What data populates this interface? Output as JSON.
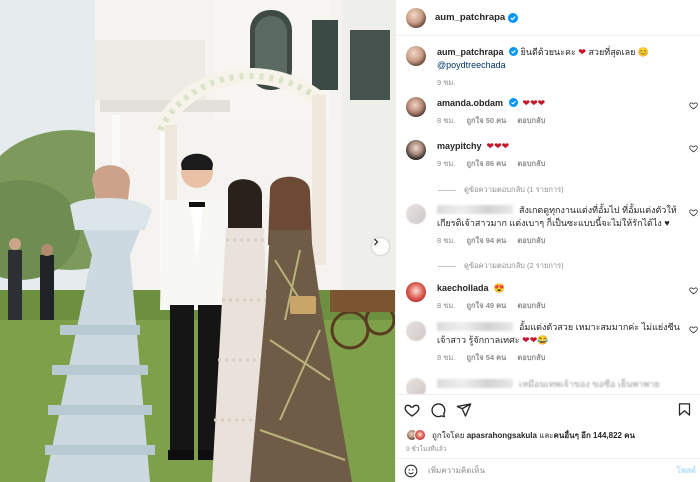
{
  "header": {
    "username": "aum_patchrapa"
  },
  "caption": {
    "username": "aum_patchrapa",
    "text": "ยินดีด้วยนะคะ",
    "text2": "สวยที่สุดเลย",
    "mention": "@poydtreechada",
    "time": "9 ชม."
  },
  "comments": [
    {
      "username": "amanda.obdam",
      "text": "",
      "time": "8 ชม.",
      "likes": "ถูกใจ 50 คน",
      "reply": "ตอบกลับ"
    },
    {
      "username": "maypitchy",
      "text": "",
      "time": "9 ชม.",
      "likes": "ถูกใจ 86 คน",
      "reply": "ตอบกลับ",
      "view_replies": "ดูข้อความตอบกลับ (1 รายการ)"
    },
    {
      "username": "",
      "text": "สังเกตดูทุกงานแต่งที่อั้มไป ที่อั้มแต่งตัวให้เกียรติเจ้าสาวมาก แต่งเบาๆ ก็เป็นซะแบบนี้จะไม่ให้รักได้ไง ♥",
      "time": "8 ชม.",
      "likes": "ถูกใจ 94 คน",
      "reply": "ตอบกลับ",
      "view_replies": "ดูข้อความตอบกลับ (2 รายการ)"
    },
    {
      "username": "kaechollada",
      "text": "",
      "time": "8 ชม.",
      "likes": "ถูกใจ 49 คน",
      "reply": "ตอบกลับ"
    },
    {
      "username": "",
      "text": "อั้มแต่งตัวสวย เหมาะสมมากค่ะ ไม่แย่งซีนเจ้าสาว รู้จักกาลเทศะ",
      "time": "8 ชม.",
      "likes": "ถูกใจ 54 คน",
      "reply": "ตอบกลับ"
    },
    {
      "username": "",
      "text": "เหมือนเทพเจ้าของ ขอซือ เย็นพาพาย",
      "time": "",
      "likes": "",
      "reply": ""
    }
  ],
  "likes": {
    "prefix": "ถูกใจโดย",
    "user": "apasrahongsakula",
    "middle": "และ",
    "others": "คนอื่นๆ",
    "count_text": "อีก 144,822 คน"
  },
  "time_ago": "9 ชั่วโมงที่แล้ว",
  "add_comment": {
    "placeholder": "เพิ่มความคิดเห็น",
    "post": "โพสต์"
  },
  "colors": {
    "accent": "#0095f6",
    "heart": "#ed4956",
    "verified": "#0095f6"
  },
  "icons": [
    "heart-icon",
    "comment-icon",
    "share-icon",
    "bookmark-icon",
    "smile-icon",
    "next-arrow-icon"
  ]
}
